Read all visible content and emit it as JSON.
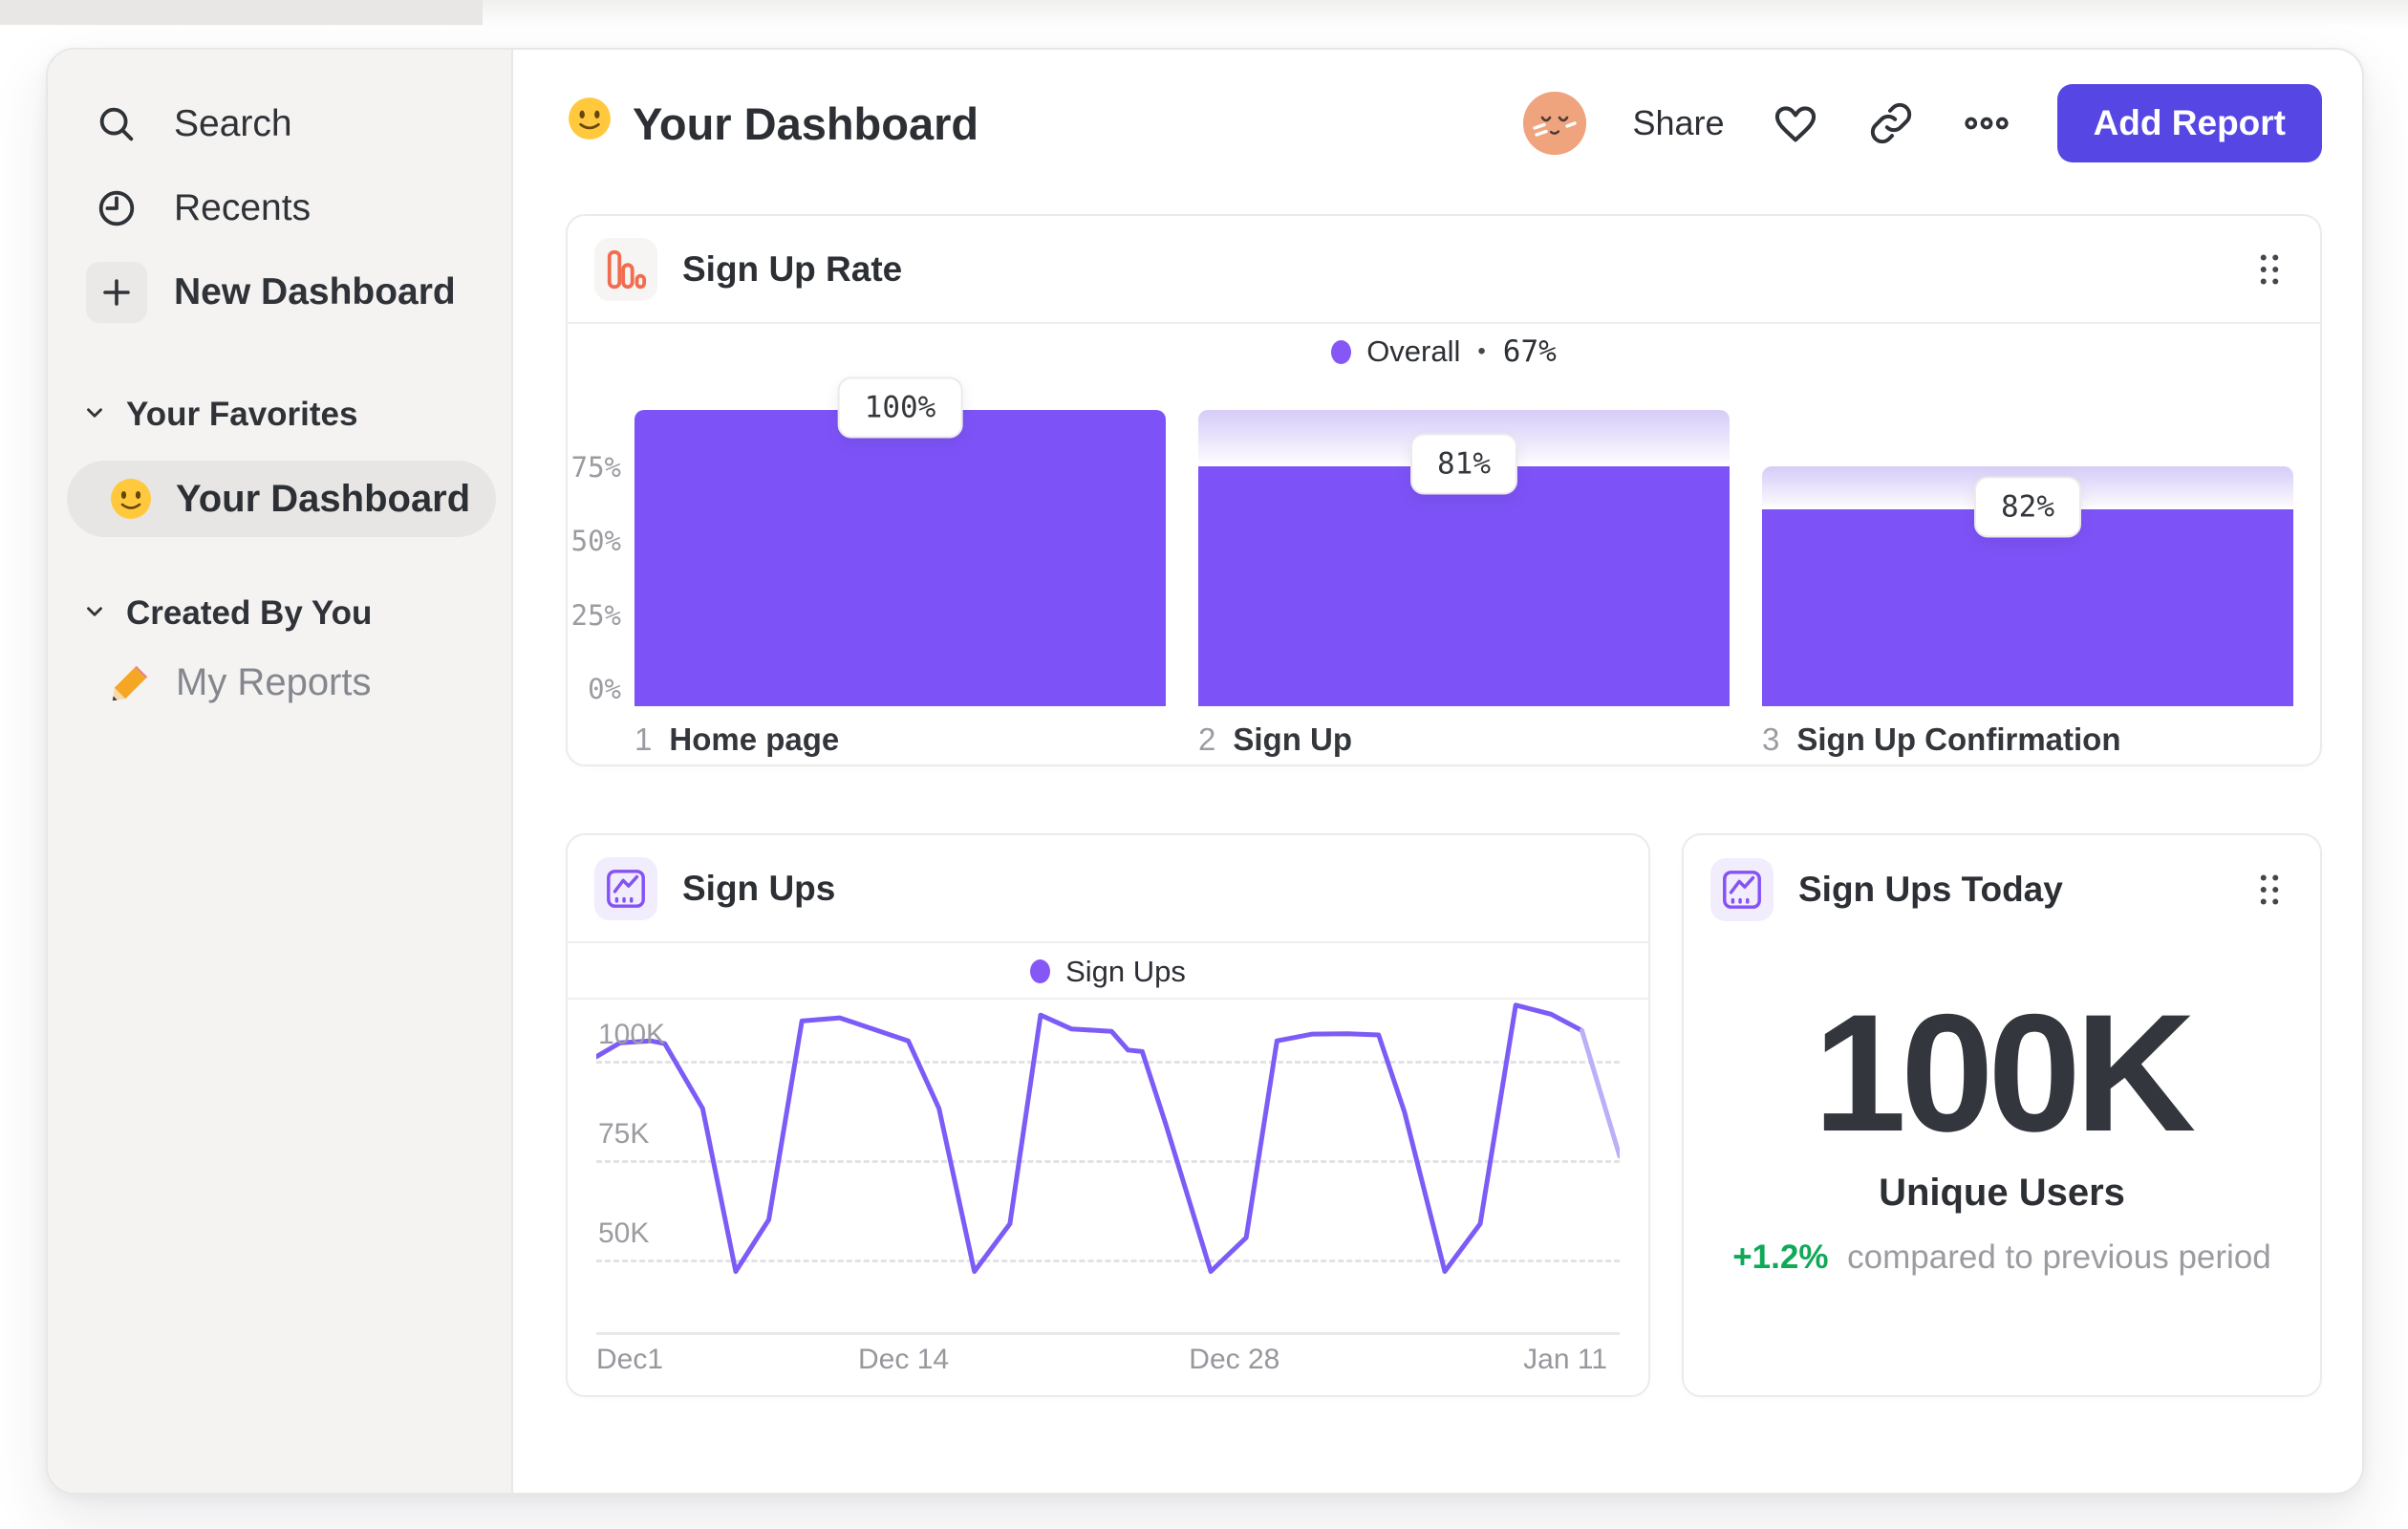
{
  "sidebar": {
    "nav": [
      {
        "label": "Search",
        "icon": "search-icon"
      },
      {
        "label": "Recents",
        "icon": "clock-icon"
      },
      {
        "label": "New Dashboard",
        "icon": "plus-icon"
      }
    ],
    "sections": [
      {
        "title": "Your Favorites",
        "items": [
          {
            "label": "Your Dashboard",
            "icon": "smiley-emoji",
            "active": true
          }
        ]
      },
      {
        "title": "Created By You",
        "items": [
          {
            "label": "My Reports",
            "icon": "pencil-emoji",
            "active": false
          }
        ]
      }
    ]
  },
  "header": {
    "title": "Your Dashboard",
    "title_emoji": "slightly-smiling-face",
    "share": "Share",
    "add_report": "Add Report",
    "icons": [
      "avatar",
      "heart-icon",
      "link-icon",
      "ellipsis-icon"
    ]
  },
  "today_card": {
    "title": "Sign Ups Today",
    "metric": "100K",
    "metric_label": "Unique Users",
    "delta": "+1.2%",
    "delta_context": "compared to previous period"
  },
  "colors": {
    "bar_purple": "#7d53f7",
    "line_purple": "#7c5bf6",
    "line_purple_incomplete": "#bdaef8",
    "legend_dot_purple": "#8657f7",
    "button_purple": "#5646e4",
    "delta_green": "#0fa958",
    "funnel_icon_orange": "#f26c4f",
    "sidebar_bg": "#f4f3f2",
    "gradient_dropoff_top": "#d6ccf8"
  },
  "chart_data": [
    {
      "type": "bar",
      "subtype": "funnel",
      "title": "Sign Up Rate",
      "legend": {
        "name": "Overall",
        "sep": "•",
        "overall_conversion": "67%"
      },
      "legend_position": "top-center",
      "ylim": [
        0,
        100
      ],
      "grid": false,
      "y_ticks": [
        {
          "label": "75%",
          "pct": 75
        },
        {
          "label": "50%",
          "pct": 50
        },
        {
          "label": "25%",
          "pct": 25
        },
        {
          "label": "0%",
          "pct": 0
        }
      ],
      "categories": [
        "Home page",
        "Sign Up",
        "Sign Up Confirmation"
      ],
      "steps": [
        {
          "num": "1",
          "label": "Home page",
          "badge": "100%",
          "conversion_from_prev_pct": 100,
          "overall_pct": 100,
          "prev_overall_pct": 100
        },
        {
          "num": "2",
          "label": "Sign Up",
          "badge": "81%",
          "conversion_from_prev_pct": 81,
          "overall_pct": 81,
          "prev_overall_pct": 100
        },
        {
          "num": "3",
          "label": "Sign Up Confirmation",
          "badge": "82%",
          "conversion_from_prev_pct": 82,
          "overall_pct": 66.4,
          "prev_overall_pct": 81
        }
      ]
    },
    {
      "type": "line",
      "title": "Sign Ups",
      "series_name": "Sign Ups",
      "unit": "K users",
      "legend_position": "top-center",
      "x_max_day": 43.3,
      "x_ticks": [
        {
          "label": "Dec1",
          "day": 0
        },
        {
          "label": "Dec 14",
          "day": 13
        },
        {
          "label": "Dec 28",
          "day": 27
        },
        {
          "label": "Jan 11",
          "day": 41
        }
      ],
      "y_ticks": [
        {
          "label": "100K",
          "value": 100
        },
        {
          "label": "75K",
          "value": 75
        },
        {
          "label": "50K",
          "value": 50
        }
      ],
      "points": [
        [
          0,
          101
        ],
        [
          1,
          104.5
        ],
        [
          2.3,
          105
        ],
        [
          2.9,
          104.3
        ],
        [
          4.5,
          88
        ],
        [
          5.9,
          47
        ],
        [
          7.3,
          60
        ],
        [
          8.7,
          110
        ],
        [
          10.3,
          110.8
        ],
        [
          11.7,
          108
        ],
        [
          13.2,
          105
        ],
        [
          14.5,
          88
        ],
        [
          16,
          47
        ],
        [
          17.5,
          59
        ],
        [
          18.8,
          111.5
        ],
        [
          20.1,
          108
        ],
        [
          21.8,
          107.4
        ],
        [
          22.5,
          102.7
        ],
        [
          23.1,
          102.3
        ],
        [
          24.1,
          84
        ],
        [
          26,
          47
        ],
        [
          27.5,
          55.5
        ],
        [
          28.8,
          105
        ],
        [
          30.3,
          106.7
        ],
        [
          31.8,
          106.8
        ],
        [
          33.1,
          106.5
        ],
        [
          34.2,
          87
        ],
        [
          35.9,
          47
        ],
        [
          37.4,
          59
        ],
        [
          38.9,
          114
        ],
        [
          40.4,
          111.7
        ],
        [
          41.7,
          107.6
        ],
        [
          43.3,
          76
        ]
      ],
      "incomplete_from_day": 41.7
    }
  ]
}
